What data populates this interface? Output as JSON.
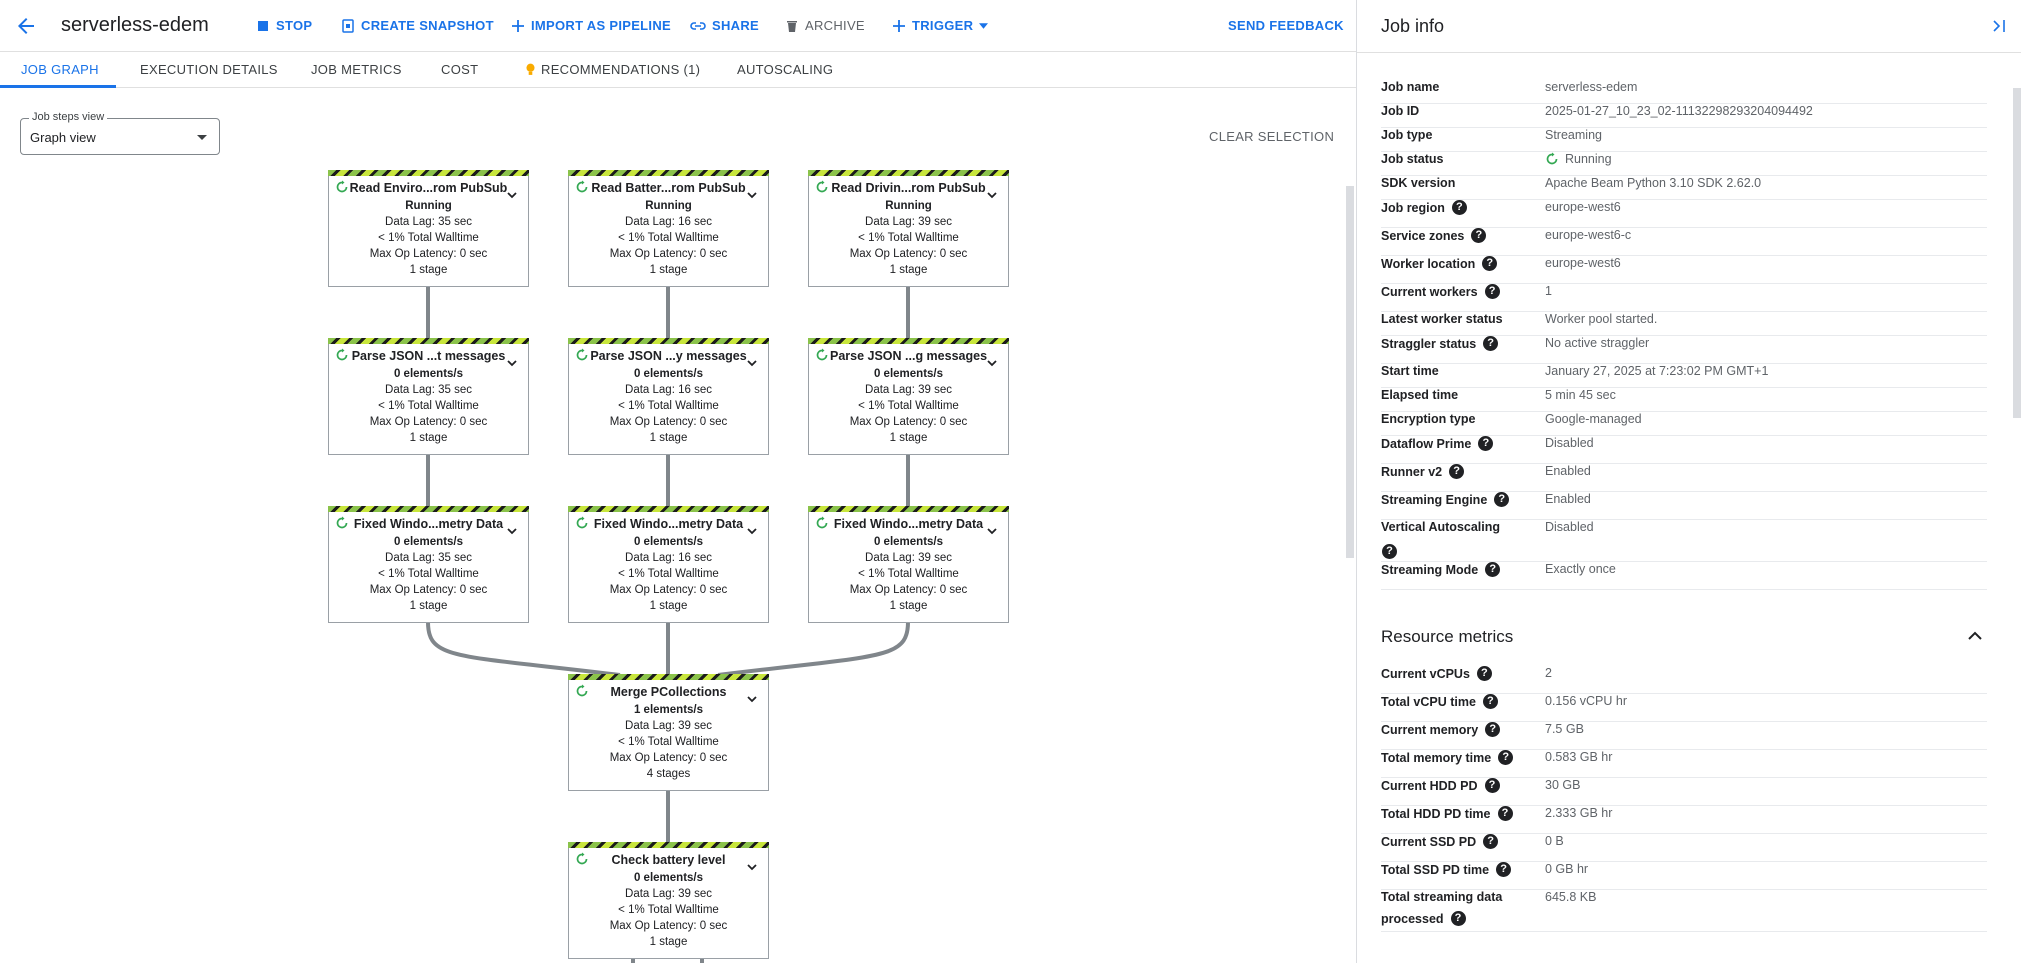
{
  "header": {
    "title": "serverless-edem",
    "actions": {
      "stop": "STOP",
      "create_snapshot": "CREATE SNAPSHOT",
      "import_pipeline": "IMPORT AS PIPELINE",
      "share": "SHARE",
      "archive": "ARCHIVE",
      "trigger": "TRIGGER",
      "send_feedback": "SEND FEEDBACK"
    }
  },
  "tabs": [
    "JOB GRAPH",
    "EXECUTION DETAILS",
    "JOB METRICS",
    "COST",
    "RECOMMENDATIONS (1)",
    "AUTOSCALING"
  ],
  "steps_view": {
    "label": "Job steps view",
    "value": "Graph view"
  },
  "clear_selection": "CLEAR SELECTION",
  "nodes": [
    {
      "title": "Read Enviro...rom PubSub",
      "lines": [
        "Running",
        "Data Lag: 35 sec",
        "< 1% Total Walltime",
        "Max Op Latency: 0 sec",
        "1 stage"
      ]
    },
    {
      "title": "Read Batter...rom PubSub",
      "lines": [
        "Running",
        "Data Lag: 16 sec",
        "< 1% Total Walltime",
        "Max Op Latency: 0 sec",
        "1 stage"
      ]
    },
    {
      "title": "Read Drivin...rom PubSub",
      "lines": [
        "Running",
        "Data Lag: 39 sec",
        "< 1% Total Walltime",
        "Max Op Latency: 0 sec",
        "1 stage"
      ]
    },
    {
      "title": "Parse JSON ...t messages",
      "lines": [
        "0 elements/s",
        "Data Lag: 35 sec",
        "< 1% Total Walltime",
        "Max Op Latency: 0 sec",
        "1 stage"
      ]
    },
    {
      "title": "Parse JSON ...y messages",
      "lines": [
        "0 elements/s",
        "Data Lag: 16 sec",
        "< 1% Total Walltime",
        "Max Op Latency: 0 sec",
        "1 stage"
      ]
    },
    {
      "title": "Parse JSON ...g messages",
      "lines": [
        "0 elements/s",
        "Data Lag: 39 sec",
        "< 1% Total Walltime",
        "Max Op Latency: 0 sec",
        "1 stage"
      ]
    },
    {
      "title": "Fixed Windo...metry Data",
      "lines": [
        "0 elements/s",
        "Data Lag: 35 sec",
        "< 1% Total Walltime",
        "Max Op Latency: 0 sec",
        "1 stage"
      ]
    },
    {
      "title": "Fixed Windo...metry Data",
      "lines": [
        "0 elements/s",
        "Data Lag: 16 sec",
        "< 1% Total Walltime",
        "Max Op Latency: 0 sec",
        "1 stage"
      ]
    },
    {
      "title": "Fixed Windo...metry Data",
      "lines": [
        "0 elements/s",
        "Data Lag: 39 sec",
        "< 1% Total Walltime",
        "Max Op Latency: 0 sec",
        "1 stage"
      ]
    },
    {
      "title": "Merge PCollections",
      "lines": [
        "1 elements/s",
        "Data Lag: 39 sec",
        "< 1% Total Walltime",
        "Max Op Latency: 0 sec",
        "4 stages"
      ]
    },
    {
      "title": "Check battery level",
      "lines": [
        "0 elements/s",
        "Data Lag: 39 sec",
        "< 1% Total Walltime",
        "Max Op Latency: 0 sec",
        "1 stage"
      ]
    }
  ],
  "panel": {
    "title": "Job info",
    "job_info": [
      {
        "key": "Job name",
        "value": "serverless-edem",
        "help": false
      },
      {
        "key": "Job ID",
        "value": "2025-01-27_10_23_02-11132298293204094492",
        "help": false
      },
      {
        "key": "Job type",
        "value": "Streaming",
        "help": false
      },
      {
        "key": "Job status",
        "value": "Running",
        "help": false,
        "status_icon": true
      },
      {
        "key": "SDK version",
        "value": "Apache Beam Python 3.10 SDK 2.62.0",
        "help": false
      },
      {
        "key": "Job region",
        "value": "europe-west6",
        "help": true
      },
      {
        "key": "Service zones",
        "value": "europe-west6-c",
        "help": true
      },
      {
        "key": "Worker location",
        "value": "europe-west6",
        "help": true
      },
      {
        "key": "Current workers",
        "value": "1",
        "help": true
      },
      {
        "key": "Latest worker status",
        "value": "Worker pool started.",
        "help": false
      },
      {
        "key": "Straggler status",
        "value": "No active straggler",
        "help": true
      },
      {
        "key": "Start time",
        "value": "January 27, 2025 at 7:23:02 PM GMT+1",
        "help": false
      },
      {
        "key": "Elapsed time",
        "value": "5 min 45 sec",
        "help": false
      },
      {
        "key": "Encryption type",
        "value": "Google-managed",
        "help": false
      },
      {
        "key": "Dataflow Prime",
        "value": "Disabled",
        "help": true
      },
      {
        "key": "Runner v2",
        "value": "Enabled",
        "help": true
      },
      {
        "key": "Streaming Engine",
        "value": "Enabled",
        "help": true
      },
      {
        "key": "Vertical Autoscaling",
        "value": "Disabled",
        "help": true,
        "help_below": true
      },
      {
        "key": "Streaming Mode",
        "value": "Exactly once",
        "help": true
      }
    ],
    "resource_title": "Resource metrics",
    "resource_metrics": [
      {
        "key": "Current vCPUs",
        "value": "2"
      },
      {
        "key": "Total vCPU time",
        "value": "0.156 vCPU hr"
      },
      {
        "key": "Current memory",
        "value": "7.5 GB"
      },
      {
        "key": "Total memory time",
        "value": "0.583 GB hr"
      },
      {
        "key": "Current HDD PD",
        "value": "30 GB"
      },
      {
        "key": "Total HDD PD time",
        "value": "2.333 GB hr"
      },
      {
        "key": "Current SSD PD",
        "value": "0 B"
      },
      {
        "key": "Total SSD PD time",
        "value": "0 GB hr"
      },
      {
        "key": "Total streaming data",
        "key2": "processed",
        "value": "645.8 KB"
      }
    ]
  }
}
